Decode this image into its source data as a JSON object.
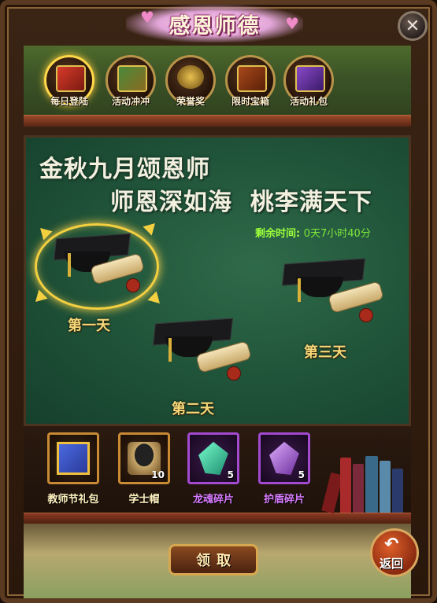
{
  "header": {
    "title": "感恩师德",
    "close_glyph": "✕"
  },
  "tabs": [
    {
      "label": "每日登陆",
      "icon": "gift-box-icon",
      "active": true
    },
    {
      "label": "活动冲冲",
      "icon": "treasure-chest-icon",
      "active": false
    },
    {
      "label": "荣誉奖",
      "icon": "reward-medal-icon",
      "active": false
    },
    {
      "label": "限时宝箱",
      "icon": "treasure-box-icon",
      "active": false
    },
    {
      "label": "活动礼包",
      "icon": "purple-gift-icon",
      "active": false
    }
  ],
  "board": {
    "slogan_line1": "金秋九月颂恩师",
    "slogan_line2": "师恩深如海  桃李满天下",
    "timer_label": "剩余时间:",
    "timer_value": "0天7小时40分"
  },
  "days": [
    {
      "label": "第一天",
      "selected": true,
      "icon": "graduation-cap-icon"
    },
    {
      "label": "第二天",
      "selected": false,
      "icon": "graduation-cap-icon"
    },
    {
      "label": "第三天",
      "selected": false,
      "icon": "graduation-cap-icon"
    }
  ],
  "rewards": [
    {
      "name": "教师节礼包",
      "count": "",
      "icon": "gift-box-icon",
      "color": "#fff2c0"
    },
    {
      "name": "学士帽",
      "count": "10",
      "icon": "graduation-cap-icon",
      "color": "#fff2c0"
    },
    {
      "name": "龙魂碎片",
      "count": "5",
      "icon": "green-crystal-icon",
      "color": "#d87cff"
    },
    {
      "name": "护盾碎片",
      "count": "5",
      "icon": "purple-crystal-icon",
      "color": "#d87cff"
    }
  ],
  "actions": {
    "claim_label": "领取",
    "back_label": "返回"
  },
  "colors": {
    "timer": "#9cff3a",
    "accent_gold": "#f4d040",
    "reward_purple": "#d87cff"
  }
}
